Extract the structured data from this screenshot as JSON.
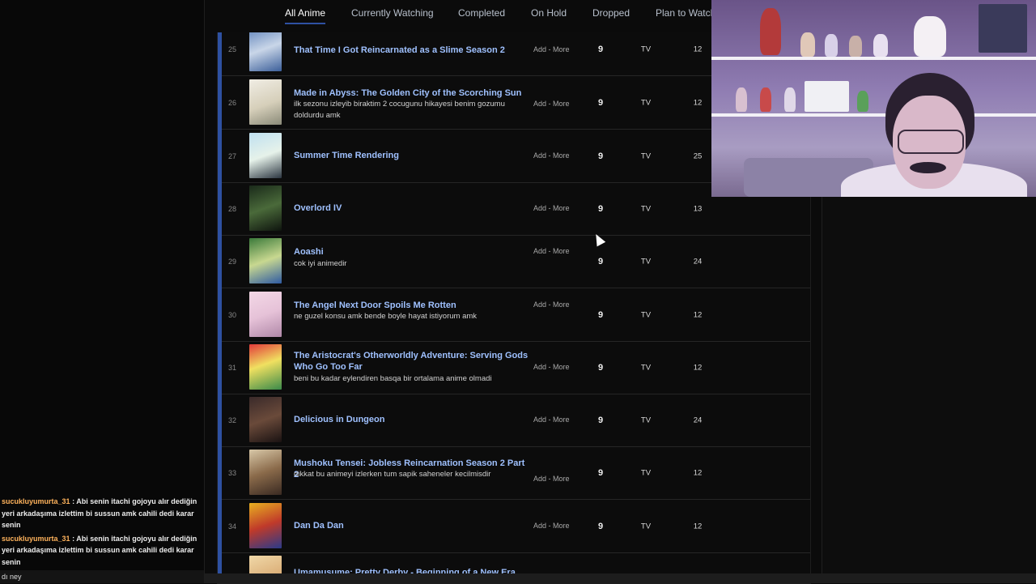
{
  "tabs": [
    {
      "label": "All Anime",
      "active": true
    },
    {
      "label": "Currently Watching"
    },
    {
      "label": "Completed"
    },
    {
      "label": "On Hold"
    },
    {
      "label": "Dropped"
    },
    {
      "label": "Plan to Watch"
    }
  ],
  "add_more_label": "Add - More",
  "accent_color": "#2e51a2",
  "rows": [
    {
      "num": "25",
      "title": "That Time I Got Reincarnated as a Slime Season 2",
      "note": "",
      "score": "9",
      "type": "TV",
      "eps": "12"
    },
    {
      "num": "26",
      "title": "Made in Abyss: The Golden City of the Scorching Sun",
      "note": "ilk sezonu izleyib biraktim 2 cocugunu hikayesi benim gozumu doldurdu amk",
      "score": "9",
      "type": "TV",
      "eps": "12"
    },
    {
      "num": "27",
      "title": "Summer Time Rendering",
      "note": "",
      "score": "9",
      "type": "TV",
      "eps": "25"
    },
    {
      "num": "28",
      "title": "Overlord IV",
      "note": "",
      "score": "9",
      "type": "TV",
      "eps": "13"
    },
    {
      "num": "29",
      "title": "Aoashi",
      "note": "cok iyi animedir",
      "score": "9",
      "type": "TV",
      "eps": "24"
    },
    {
      "num": "30",
      "title": "The Angel Next Door Spoils Me Rotten",
      "note": "ne guzel konsu amk bende boyle hayat istiyorum amk",
      "score": "9",
      "type": "TV",
      "eps": "12"
    },
    {
      "num": "31",
      "title": "The Aristocrat's Otherworldly Adventure: Serving Gods Who Go Too Far",
      "note": "beni bu kadar eylendiren basqa bir ortalama anime olmadi",
      "score": "9",
      "type": "TV",
      "eps": "12"
    },
    {
      "num": "32",
      "title": "Delicious in Dungeon",
      "note": "",
      "score": "9",
      "type": "TV",
      "eps": "24"
    },
    {
      "num": "33",
      "title": "Mushoku Tensei: Jobless Reincarnation Season 2 Part 2",
      "note": "dikkat bu animeyi izlerken tum sapik saheneler kecilmisdir",
      "score": "9",
      "type": "TV",
      "eps": "12"
    },
    {
      "num": "34",
      "title": "Dan Da Dan",
      "note": "",
      "score": "9",
      "type": "TV",
      "eps": "12"
    },
    {
      "num": "",
      "title": "Umamusume: Pretty Derby - Beginning of a New Era",
      "note": "",
      "score": "",
      "type": "",
      "eps": ""
    }
  ],
  "chat": {
    "messages": [
      {
        "user": "sucukluyumurta_31",
        "text": ": Abi senin itachi gojoyu alır dediğin yeri arkadaşıma izlettim bi sussun amk cahili dedi karar senin"
      },
      {
        "user": "sucukluyumurta_31",
        "text": ": Abi senin itachi gojoyu alır dediğin yeri arkadaşıma izlettim bi sussun amk cahili dedi karar senin"
      }
    ],
    "bottom_text": "dı ney"
  }
}
